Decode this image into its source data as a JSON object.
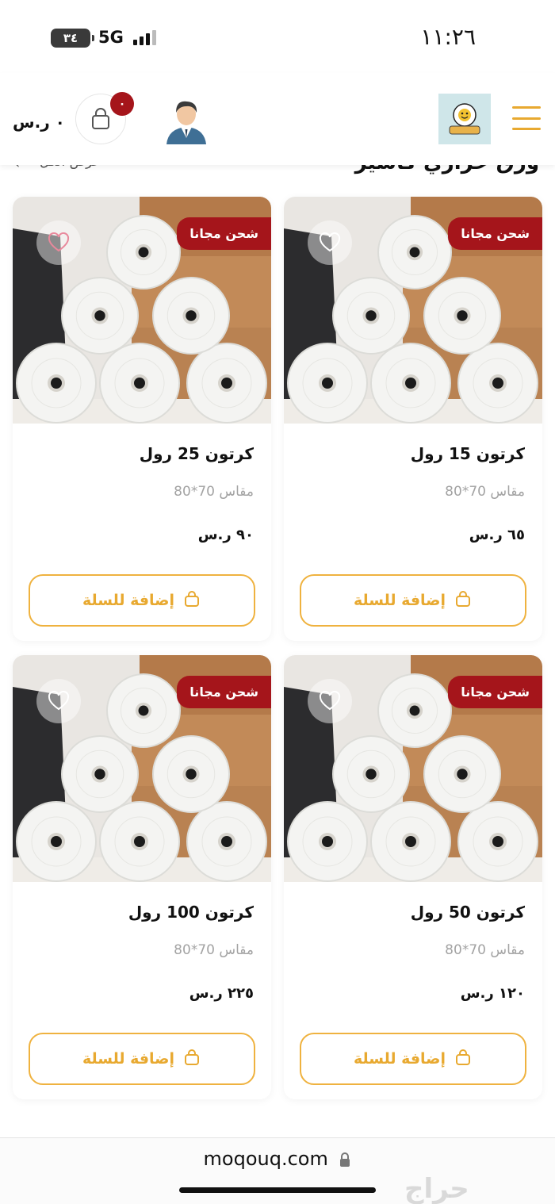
{
  "status_bar": {
    "time": "١١:٢٦",
    "network": "5G",
    "battery": "٣٤"
  },
  "header": {
    "cart_total": "٠ ر.س",
    "cart_count": "٠"
  },
  "section": {
    "title": "ورق حراري كاشير",
    "view_all": "عرض الكل"
  },
  "products": [
    {
      "name": "كرتون 15 رول",
      "size": "مقاس 70*80",
      "price": "٦٥ ر.س",
      "badge": "شحن مجانا",
      "add_label": "إضافة للسلة"
    },
    {
      "name": "كرتون 25 رول",
      "size": "مقاس 70*80",
      "price": "٩٠ ر.س",
      "badge": "شحن مجانا",
      "add_label": "إضافة للسلة"
    },
    {
      "name": "كرتون 50 رول",
      "size": "مقاس 70*80",
      "price": "١٢٠ ر.س",
      "badge": "شحن مجانا",
      "add_label": "إضافة للسلة"
    },
    {
      "name": "كرتون 100 رول",
      "size": "مقاس 70*80",
      "price": "٢٢٥ ر.س",
      "badge": "شحن مجانا",
      "add_label": "إضافة للسلة"
    }
  ],
  "footer": {
    "url": "moqouq.com",
    "watermark": "حراج"
  },
  "colors": {
    "accent": "#e8a930",
    "badge": "#a5151b",
    "background": "#ffffff"
  },
  "icons": [
    "menu-icon",
    "logo",
    "avatar-icon",
    "shopping-bag-icon",
    "heart-icon",
    "lock-icon",
    "chevron-left-icon"
  ]
}
